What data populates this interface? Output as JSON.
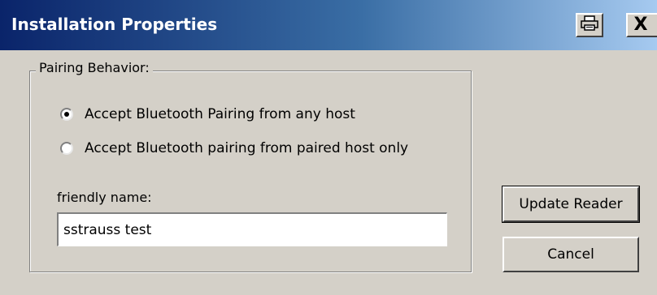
{
  "window": {
    "title": "Installation Properties",
    "help_icon": "printer-icon",
    "close_label": "X"
  },
  "group": {
    "legend": "Pairing Behavior:"
  },
  "radios": [
    {
      "label": "Accept Bluetooth Pairing from any host",
      "checked": true
    },
    {
      "label": "Accept Bluetooth pairing from paired host only",
      "checked": false
    }
  ],
  "friendly_name": {
    "label": "friendly name:",
    "value": "sstrauss test"
  },
  "buttons": {
    "update": "Update Reader",
    "cancel": "Cancel"
  }
}
